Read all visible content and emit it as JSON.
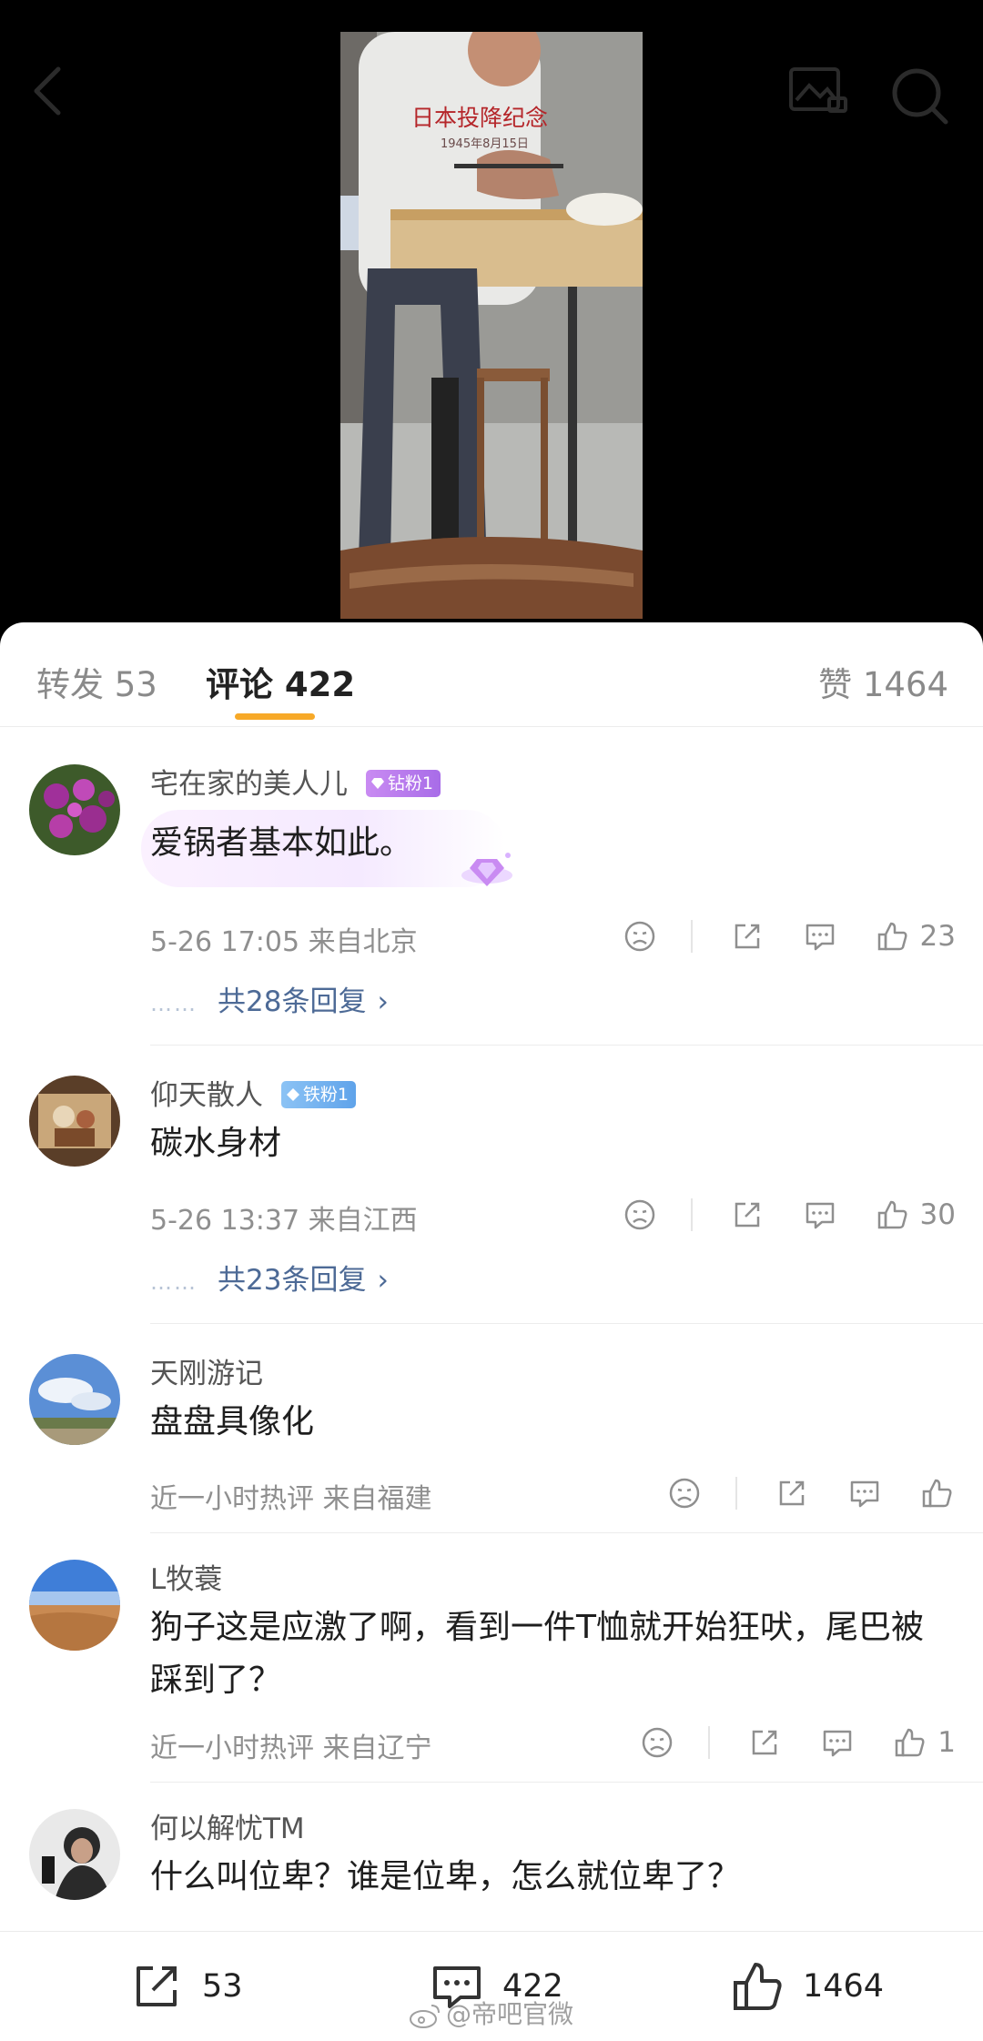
{
  "video": {
    "shirt_line1": "日本投降纪念",
    "shirt_line2": "1945年8月15日"
  },
  "tabs": {
    "repost": "转发 53",
    "comment": "评论 422",
    "like": "赞 1464"
  },
  "comments": [
    {
      "username": "宅在家的美人儿",
      "badge": "钻粉1",
      "content": "爱锅者基本如此。",
      "meta": "5-26 17:05  来自北京",
      "likes": "23",
      "replies": "共28条回复"
    },
    {
      "username": "仰天散人",
      "badge": "铁粉1",
      "content": "碳水身材",
      "meta": "5-26 13:37  来自江西",
      "likes": "30",
      "replies": "共23条回复"
    },
    {
      "username": "天刚游记",
      "content": "盘盘具像化",
      "meta": "近一小时热评  来自福建",
      "likes": ""
    },
    {
      "username": "L牧蓑",
      "content": "狗子这是应激了啊，看到一件T恤就开始狂吠，尾巴被踩到了？",
      "meta": "近一小时热评  来自辽宁",
      "likes": "1"
    },
    {
      "username": "何以解忧TM",
      "content": "什么叫位卑？谁是位卑，怎么就位卑了？"
    }
  ],
  "bottom_bar": {
    "repost_count": "53",
    "comment_count": "422",
    "like_count": "1464"
  },
  "watermark": "@帝吧官微",
  "colors": {
    "accent_underline": "#f7a928",
    "reply_link": "#4d6a96",
    "badge_diamond": "#b47aee",
    "badge_iron": "#6aaeed"
  },
  "icons": [
    "back-icon",
    "picture-icon",
    "search-icon",
    "dislike-icon",
    "share-icon",
    "comment-icon",
    "like-icon",
    "chevron-right-icon",
    "weibo-icon"
  ]
}
